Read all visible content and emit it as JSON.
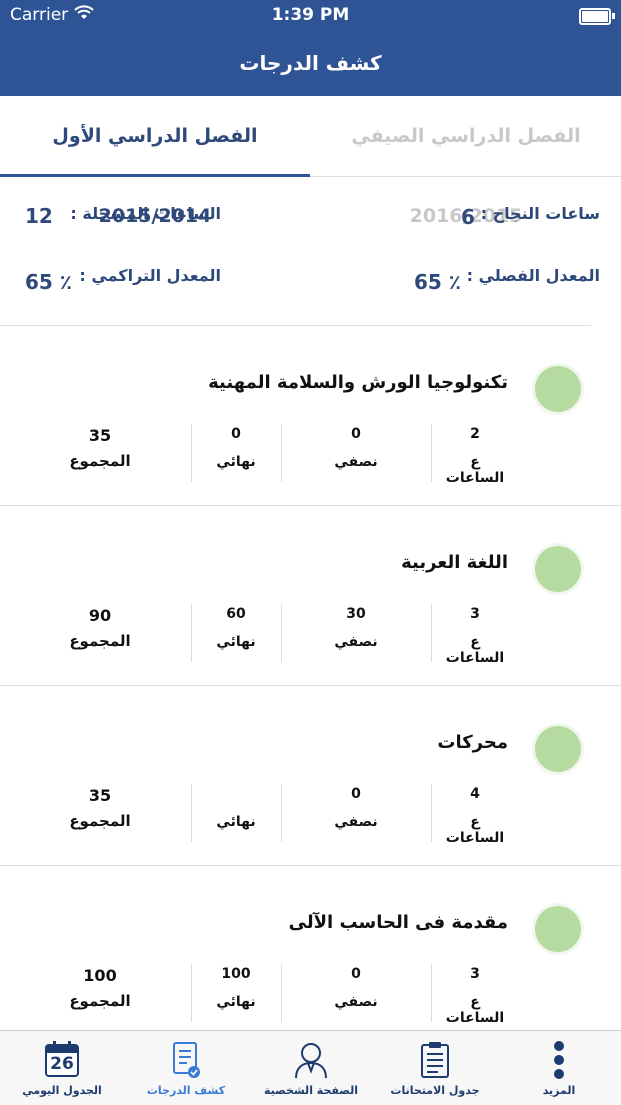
{
  "status_bar": {
    "carrier": "Carrier",
    "time": "1:39 PM"
  },
  "nav": {
    "title": "كشف الدرجات"
  },
  "tabs": [
    {
      "label": "الفصل الدراسي الأول 2015/2014",
      "active": true
    },
    {
      "label": "الفصل الدراسي الصيفي 2016/2015",
      "active": false
    }
  ],
  "summary": {
    "registered_hours_label": "الساعات المسجلة :",
    "registered_hours_value": "12",
    "passed_hours_label": "ساعات النجاح :",
    "passed_hours_value": "6",
    "cumulative_gpa_label": "المعدل التراكمي :",
    "cumulative_gpa_value": "65 ٪",
    "semester_gpa_label": "المعدل الفصلي :",
    "semester_gpa_value": "65 ٪"
  },
  "labels": {
    "hours": "ع الساعات",
    "midterm": "نصفي",
    "final": "نهائي",
    "total": "المجموع"
  },
  "courses": [
    {
      "name": "تكنولوجيا الورش والسلامة المهنية",
      "hours": "2",
      "midterm": "0",
      "final": "0",
      "total": "35"
    },
    {
      "name": "اللغة العربية",
      "hours": "3",
      "midterm": "30",
      "final": "60",
      "total": "90"
    },
    {
      "name": "محركات",
      "hours": "4",
      "midterm": "0",
      "final": "",
      "total": "35"
    },
    {
      "name": "مقدمة فى الحاسب الآلى",
      "hours": "3",
      "midterm": "0",
      "final": "100",
      "total": "100"
    }
  ],
  "tabbar": {
    "more": "المزيد",
    "exams": "جدول الامتحانات",
    "profile": "الصفحة الشخصية",
    "grades": "كشف الدرجات",
    "daily": "الجدول اليومي",
    "calendar_day": "26"
  },
  "colors": {
    "primary": "#2f5496",
    "active_tab": "#3a7bd5",
    "course_dot": "#b5dba0"
  }
}
